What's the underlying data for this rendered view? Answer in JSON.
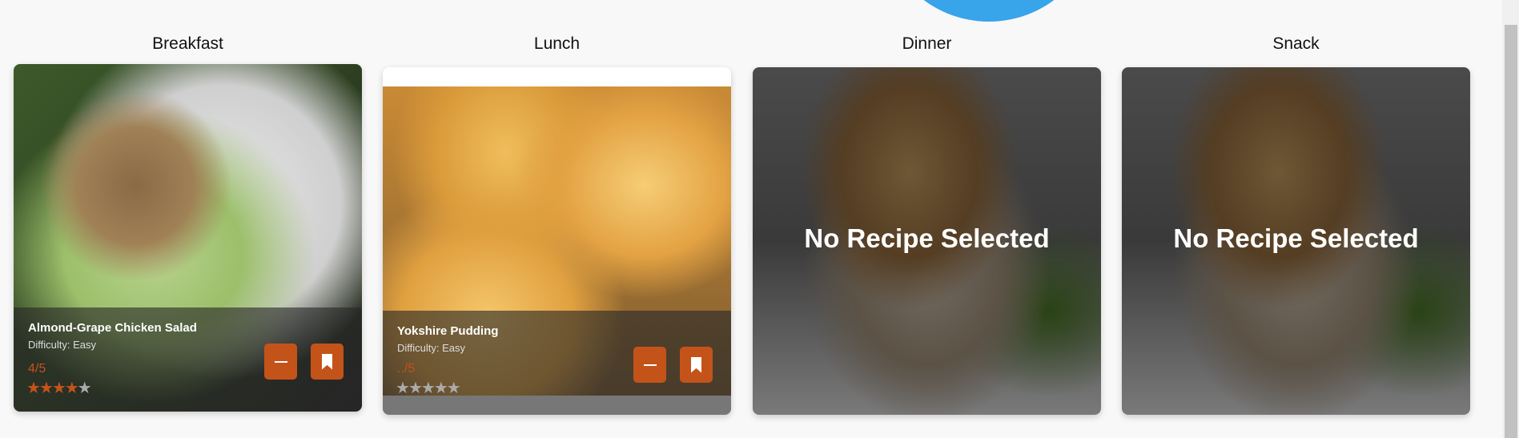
{
  "meals": [
    {
      "label": "Breakfast",
      "recipe": {
        "title": "Almond-Grape Chicken Salad",
        "difficulty": "Difficulty: Easy",
        "rating_text": "4/5",
        "rating": 4
      }
    },
    {
      "label": "Lunch",
      "recipe": {
        "title": "Yokshire Pudding",
        "difficulty": "Difficulty: Easy",
        "rating_text": "../5",
        "rating": 0
      }
    },
    {
      "label": "Dinner",
      "empty_text": "No Recipe Selected"
    },
    {
      "label": "Snack",
      "empty_text": "No Recipe Selected"
    }
  ],
  "max_rating": 5,
  "colors": {
    "accent": "#c4531a",
    "circle": "#38a4ea"
  },
  "icons": {
    "remove": "minus-icon",
    "save": "bookmark-icon"
  }
}
